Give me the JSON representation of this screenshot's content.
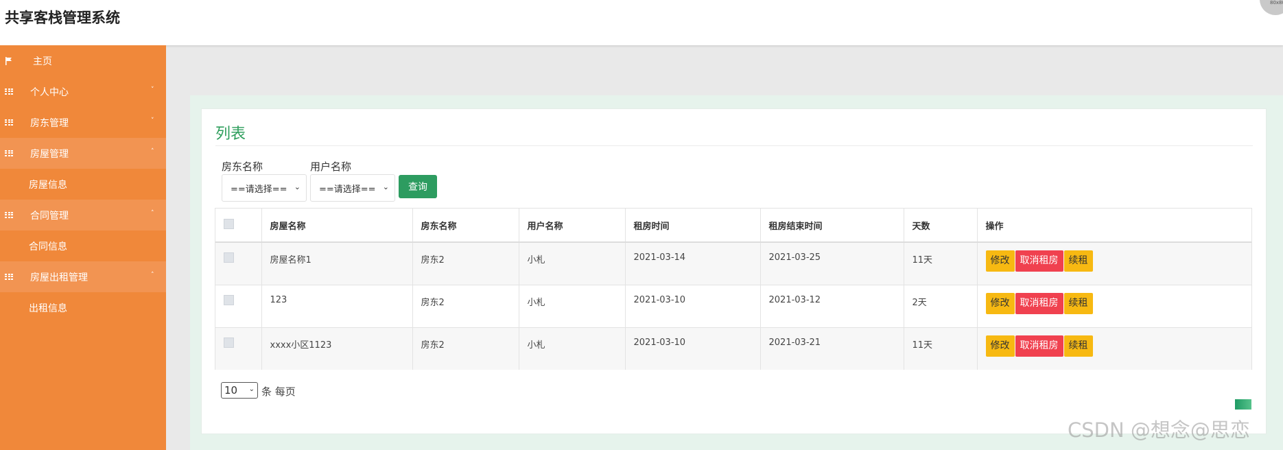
{
  "app": {
    "title": "共享客栈管理系统",
    "avatar_text": "80x80"
  },
  "sidebar": {
    "items": [
      {
        "label": "主页",
        "icon": "flag-icon"
      },
      {
        "label": "个人中心",
        "icon": "grid-icon",
        "chevron": "˅"
      },
      {
        "label": "房东管理",
        "icon": "grid-icon",
        "chevron": "˅"
      },
      {
        "label": "房屋管理",
        "icon": "grid-icon",
        "chevron": "˄"
      },
      {
        "label": "房屋信息"
      },
      {
        "label": "合同管理",
        "icon": "grid-icon",
        "chevron": "˄"
      },
      {
        "label": "合同信息"
      },
      {
        "label": "房屋出租管理",
        "icon": "grid-icon",
        "chevron": "˄"
      },
      {
        "label": "出租信息"
      }
    ]
  },
  "main": {
    "title": "列表",
    "filters": {
      "landlord_label": "房东名称",
      "landlord_value": "==请选择==",
      "user_label": "用户名称",
      "user_value": "==请选择==",
      "query_label": "查询"
    },
    "table": {
      "columns": [
        "房屋名称",
        "房东名称",
        "用户名称",
        "租房时间",
        "租房结束时间",
        "天数",
        "操作"
      ],
      "rows": [
        {
          "house": "房屋名称1",
          "landlord": "房东2",
          "user": "小札",
          "start": "2021-03-14",
          "end": "2021-03-25",
          "days": "11天"
        },
        {
          "house": "123",
          "landlord": "房东2",
          "user": "小札",
          "start": "2021-03-10",
          "end": "2021-03-12",
          "days": "2天"
        },
        {
          "house": "xxxx小区1123",
          "landlord": "房东2",
          "user": "小札",
          "start": "2021-03-10",
          "end": "2021-03-21",
          "days": "11天"
        }
      ],
      "actions": {
        "edit": "修改",
        "cancel": "取消租房",
        "renew": "续租"
      }
    },
    "pagination": {
      "page_size": "10",
      "page_size_label": "条 每页"
    }
  },
  "watermark": "CSDN @想念@思恋",
  "colors": {
    "sidebar": "#f0883a",
    "accent_green": "#2d9c60",
    "warning": "#f7b912",
    "danger": "#f0414f"
  }
}
